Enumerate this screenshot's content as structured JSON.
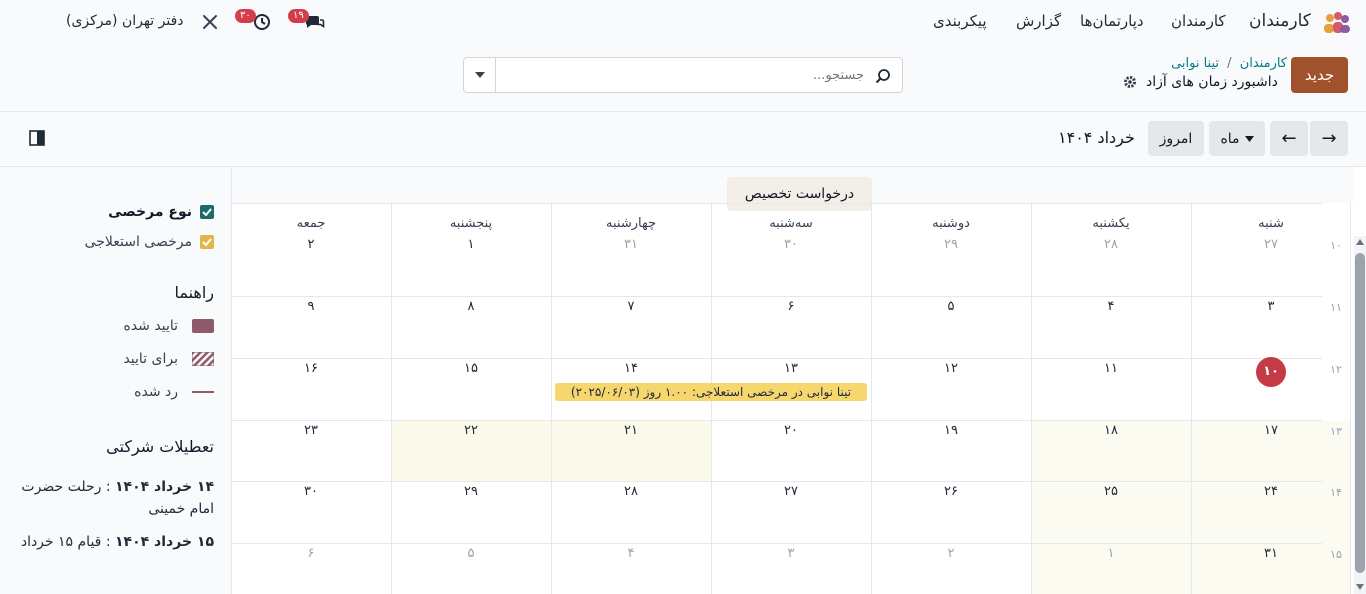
{
  "topbar": {
    "app_name": "کارمندان",
    "menu": [
      "کارمندان",
      "دپارتمان‌ها",
      "گزارش",
      "پیکربندی"
    ],
    "company": "دفتر تهران (مرکزی)",
    "chat_badge": "۱۹",
    "activity_badge": "۳۰"
  },
  "control_panel": {
    "new_button": "جدید",
    "breadcrumb_root": "کارمندان",
    "breadcrumb_sep": "/",
    "breadcrumb_item": "تینا نوابی",
    "page_title": "داشبورد زمان های آزاد",
    "search_placeholder": "جستجو..."
  },
  "toolbar": {
    "next": "→",
    "prev": "←",
    "scale": "ماه",
    "today": "امروز",
    "period": "خرداد ۱۴۰۴"
  },
  "calendar": {
    "allocation_button": "درخواست تخصیص",
    "weekdays": [
      "شنبه",
      "یکشنبه",
      "دوشنبه",
      "سه‌شنبه",
      "چهارشنبه",
      "پنجشنبه",
      "جمعه"
    ],
    "week_numbers": [
      "۱۰",
      "۱۱",
      "۱۲",
      "۱۳",
      "۱۴",
      "۱۵"
    ],
    "weeks": [
      [
        "۲۷",
        "۲۸",
        "۲۹",
        "۳۰",
        "۳۱",
        "۱",
        "۲"
      ],
      [
        "۳",
        "۴",
        "۵",
        "۶",
        "۷",
        "۸",
        "۹"
      ],
      [
        "۱۰",
        "۱۱",
        "۱۲",
        "۱۳",
        "۱۴",
        "۱۵",
        "۱۶"
      ],
      [
        "۱۷",
        "۱۸",
        "۱۹",
        "۲۰",
        "۲۱",
        "۲۲",
        "۲۳"
      ],
      [
        "۲۴",
        "۲۵",
        "۲۶",
        "۲۷",
        "۲۸",
        "۲۹",
        "۳۰"
      ],
      [
        "۳۱",
        "۱",
        "۲",
        "۳",
        "۴",
        "۵",
        "۶"
      ]
    ],
    "event_text": "تینا نوابی در مرخصی استعلاجی: ۱.۰۰ روز (۲۰۲۵/۰۶/۰۳)",
    "event_color": "#f5d76e",
    "today_color": "#c43b45"
  },
  "sidebar": {
    "filter_all": "نوع مرخصی",
    "filter_sick": "مرخصی استعلاجی",
    "guide_title": "راهنما",
    "approved": "تایید شده",
    "to_approve": "برای تایید",
    "refused": "رد شده",
    "holidays_title": "تعطیلات شرکتی",
    "holiday1_date": "۱۴ خرداد ۱۴۰۴",
    "holiday1_sep": ":",
    "holiday1_name": "رحلت حضرت امام خمینی",
    "holiday2_date": "۱۵ خرداد ۱۴۰۴",
    "holiday2_sep": ":",
    "holiday2_name": "قیام ۱۵ خرداد"
  }
}
